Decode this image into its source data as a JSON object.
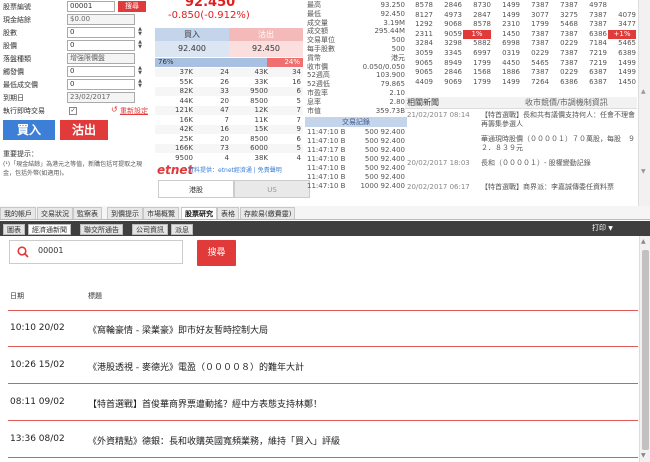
{
  "order_form": {
    "stock_code_label": "股票編號",
    "stock_code_value": "00001",
    "search_button": "搜尋",
    "cash_label": "現金結餘",
    "cash_value": "$0.00",
    "shares_label": "股數",
    "shares_value": "0",
    "price_label": "股價",
    "price_value": "0",
    "order_type_label": "落盤種類",
    "order_type_value": "增強限價盤",
    "trigger_label": "觸發價",
    "trigger_value": "0",
    "min_lot_label": "最低成交價",
    "min_lot_value": "0",
    "expiry_label": "到期日",
    "expiry_value": "23/02/2017",
    "exec_label": "執行即時交易",
    "reset_label": "重新設定",
    "buy_button": "買入",
    "sell_button": "沽出",
    "notice_title": "重要提示：",
    "notice_text": "(¹)「現金結餘」為港元之等值，新購包括可提取之現金，包括外幣(如適用)。"
  },
  "price_panel": {
    "price_top": "92.450",
    "change": "-0.850(-0.912%)",
    "buy_label": "買入",
    "sell_label": "沽出",
    "bid": "92.400",
    "ask": "92.450",
    "bid_pct": "76%",
    "ask_pct": "24%",
    "queue": [
      [
        "37K",
        "24",
        "43K",
        "34"
      ],
      [
        "55K",
        "26",
        "33K",
        "16"
      ],
      [
        "82K",
        "33",
        "9500",
        "6"
      ],
      [
        "44K",
        "20",
        "8500",
        "5"
      ],
      [
        "121K",
        "47",
        "12K",
        "7"
      ],
      [
        "16K",
        "7",
        "11K",
        "7"
      ],
      [
        "42K",
        "16",
        "15K",
        "9"
      ],
      [
        "25K",
        "20",
        "8500",
        "6"
      ],
      [
        "166K",
        "73",
        "6000",
        "5"
      ],
      [
        "9500",
        "4",
        "38K",
        "4"
      ]
    ],
    "source_label": "資料提供：etnet經濟通 | 免責聲明",
    "brand": "etnet",
    "bottom_tab1": "港股",
    "bottom_tab2": "US"
  },
  "stats": [
    [
      "最高",
      "93.250"
    ],
    [
      "最低",
      "92.450"
    ],
    [
      "成交量",
      "3.19M"
    ],
    [
      "成交額",
      "295.44M"
    ],
    [
      "交易單位",
      "500"
    ],
    [
      "每手股數",
      "500"
    ],
    [
      "貨幣",
      "港元"
    ],
    [
      "收市價",
      "0.050/0.050"
    ],
    [
      "52週高",
      "103.900"
    ],
    [
      "52週低",
      "79.865"
    ],
    [
      "市盈率",
      "2.10"
    ],
    [
      "息率",
      "2.80"
    ],
    [
      "市值",
      "359.73B"
    ]
  ],
  "trades_header": "交易記錄",
  "trades": [
    [
      "11:47:10 B",
      "500 92.400"
    ],
    [
      "11:47:10 B",
      "500 92.400"
    ],
    [
      "11:47:17 B",
      "500 92.400"
    ],
    [
      "11:47:10 B",
      "500 92.400"
    ],
    [
      "11:47:10 B",
      "500 92.400"
    ],
    [
      "11:47:10 B",
      "500 92.400"
    ],
    [
      "11:47:10 B",
      "1000 92.400"
    ]
  ],
  "quote_grid": [
    [
      "8578",
      "2846",
      "8730",
      "1499",
      "7387",
      "7387",
      "4978"
    ],
    [
      "8127",
      "4973",
      "2847",
      "1499",
      "3077",
      "3275",
      "7387",
      "4079"
    ],
    [
      "1292",
      "9068",
      "8578",
      "2310",
      "1799",
      "5468",
      "7387",
      "3477"
    ],
    [
      "2311",
      "9059",
      "1%",
      "1450",
      "7387",
      "7387",
      "6386",
      "+1%"
    ],
    [
      "3284",
      "3298",
      "5882",
      "6998",
      "7387",
      "0229",
      "7184",
      "5465"
    ],
    [
      "3059",
      "3345",
      "6997",
      "0319",
      "0229",
      "7387",
      "7219",
      "6389"
    ],
    [
      "9065",
      "8949",
      "1799",
      "4450",
      "5465",
      "7387",
      "7219",
      "1499"
    ],
    [
      "9065",
      "2846",
      "1568",
      "1886",
      "7387",
      "0229",
      "6387",
      "1499"
    ],
    [
      "4409",
      "9069",
      "1799",
      "1499",
      "7264",
      "6386",
      "6387",
      "1450"
    ]
  ],
  "news_header": "相關新聞",
  "news_header2": "收市競價/市調機制資訊",
  "related_news": [
    [
      "21/02/2017 08:14",
      "【特首選戰】長和共有議價支持何人：任會不理會再籌集參選人"
    ],
    [
      "",
      "華通現時股價（００００１）７０萬股，每股　９２．８３９元"
    ],
    [
      "20/02/2017 18:03",
      "長和（００００１）- 股權變動記錄"
    ],
    [
      "20/02/2017 06:17",
      "【特首選戰】商界派：李嘉誠傳委任資料票"
    ]
  ],
  "nav_tabs": [
    "我的帳戶",
    "交易狀況",
    "監察表",
    "到價提示",
    "市場概覽",
    "股票研究",
    "表格",
    "存款易(繳費靈)"
  ],
  "sub_tabs": [
    "圖表",
    "經濟通新聞",
    "聯交所通告",
    "公司資訊",
    "派息"
  ],
  "print_label": "打印",
  "search": {
    "value": "00001",
    "button": "搜尋"
  },
  "table_headers": {
    "date": "日期",
    "title": "標題"
  },
  "news_list": [
    {
      "date": "10:10 20/02",
      "title": "《窩輪豪情 - 梁業豪》即市好友暫時控制大局"
    },
    {
      "date": "10:26 15/02",
      "title": "《港股透視 - 麥德光》電盈（００００８）的難年大計"
    },
    {
      "date": "08:11 09/02",
      "title": "【特首選戰】首俊華商界票遭動搖？經中方表態支持林鄭！"
    },
    {
      "date": "13:36 08/02",
      "title": "《外資精點》德銀：長和收購英國寬頻業務，維持「買入」評級"
    }
  ],
  "colors": {
    "accent_red": "#e03a3a",
    "buy_blue_bg": "#c4d4ea",
    "sell_red_bg": "#f4b9b9",
    "bid_bar": "#a9c1e0",
    "ask_bar": "#f07070",
    "down_red": "#e02020"
  }
}
